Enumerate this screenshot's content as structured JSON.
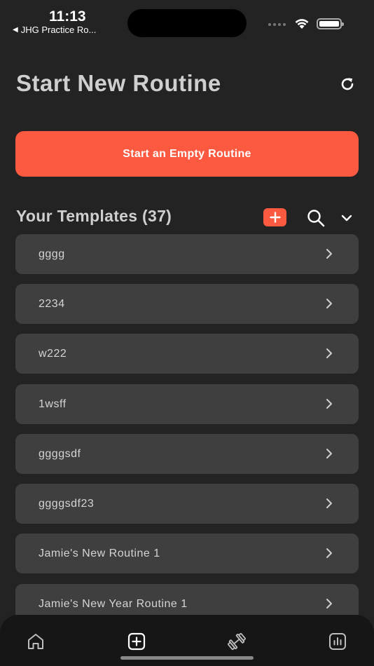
{
  "status_bar": {
    "time": "11:13",
    "back_app": "JHG Practice Ro..."
  },
  "header": {
    "title": "Start New Routine",
    "refresh_icon": "refresh-icon"
  },
  "start_button": {
    "label": "Start an Empty Routine",
    "color": "#fb5a40"
  },
  "templates_section": {
    "title": "Your Templates (37)",
    "add_icon": "plus-icon",
    "search_icon": "search-icon",
    "collapse_icon": "chevron-down-icon"
  },
  "templates": [
    {
      "name": "gggg"
    },
    {
      "name": "2234"
    },
    {
      "name": "w222"
    },
    {
      "name": "1wsff"
    },
    {
      "name": "ggggsdf"
    },
    {
      "name": "ggggsdf23"
    },
    {
      "name": "Jamie's New Routine 1"
    },
    {
      "name": "Jamie's New Year Routine 1"
    }
  ],
  "tab_bar": {
    "tabs": [
      {
        "icon": "home-icon"
      },
      {
        "icon": "plus-square-icon"
      },
      {
        "icon": "dumbbell-icon"
      },
      {
        "icon": "chart-icon"
      }
    ]
  },
  "colors": {
    "background": "#232323",
    "card": "#3f3f3f",
    "accent": "#fb5a40",
    "tab_bar": "#161616"
  }
}
